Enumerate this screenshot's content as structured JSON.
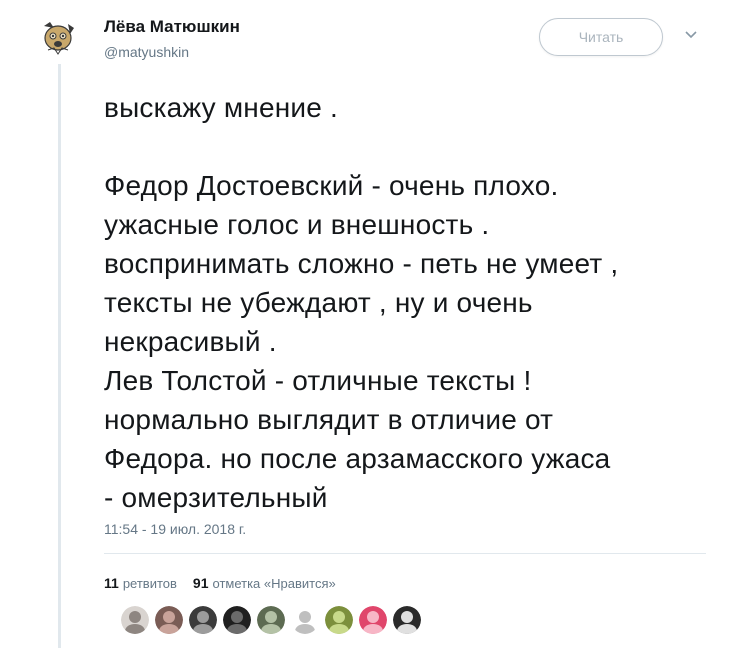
{
  "author": {
    "name": "Лёва Матюшкин",
    "handle": "@matyushkin"
  },
  "follow_button": {
    "label": "Читать"
  },
  "tweet": {
    "text": "выскажу мнение .\n\nФедор Достоевский - очень плохо.\nужасные голос и внешность .\nвоспринимать сложно - петь не умеет ,\nтексты не убеждают , ну и очень\nнекрасивый .\nЛев Толстой - отличные тексты !\nнормально выглядит в отличие от\nФедора. но после арзамасского ужаса\n- омерзительный",
    "timestamp": "11:54 - 19 июл. 2018 г."
  },
  "stats": {
    "retweets_count": "11",
    "retweets_label": "ретвитов",
    "likes_count": "91",
    "likes_label": "отметка «Нравится»"
  },
  "icons": {
    "caret": "chevron-down-icon",
    "avatar": "dog-avatar-icon"
  },
  "colors": {
    "text": "#14171a",
    "secondary": "#657786",
    "divider": "#e1e8ed",
    "follow_border": "#bfc8d0"
  },
  "likers": [
    {
      "name": "liker-avatar-1",
      "bg": "#d9d4d0",
      "fg": "#8e8681"
    },
    {
      "name": "liker-avatar-2",
      "bg": "#7a5c55",
      "fg": "#c9a39a"
    },
    {
      "name": "liker-avatar-3",
      "bg": "#3b3b3b",
      "fg": "#9c9c9c"
    },
    {
      "name": "liker-avatar-4",
      "bg": "#1f1f1f",
      "fg": "#6b6b6b"
    },
    {
      "name": "liker-avatar-5",
      "bg": "#5d6b52",
      "fg": "#b4c2a6"
    },
    {
      "name": "liker-avatar-6",
      "bg": "#ffffff",
      "fg": "#bfbfbf"
    },
    {
      "name": "liker-avatar-7",
      "bg": "#7c8f3c",
      "fg": "#c8d98a"
    },
    {
      "name": "liker-avatar-8",
      "bg": "#e0466b",
      "fg": "#f7b6c6"
    },
    {
      "name": "liker-avatar-9",
      "bg": "#2a2a2a",
      "fg": "#e0e0e0"
    }
  ]
}
